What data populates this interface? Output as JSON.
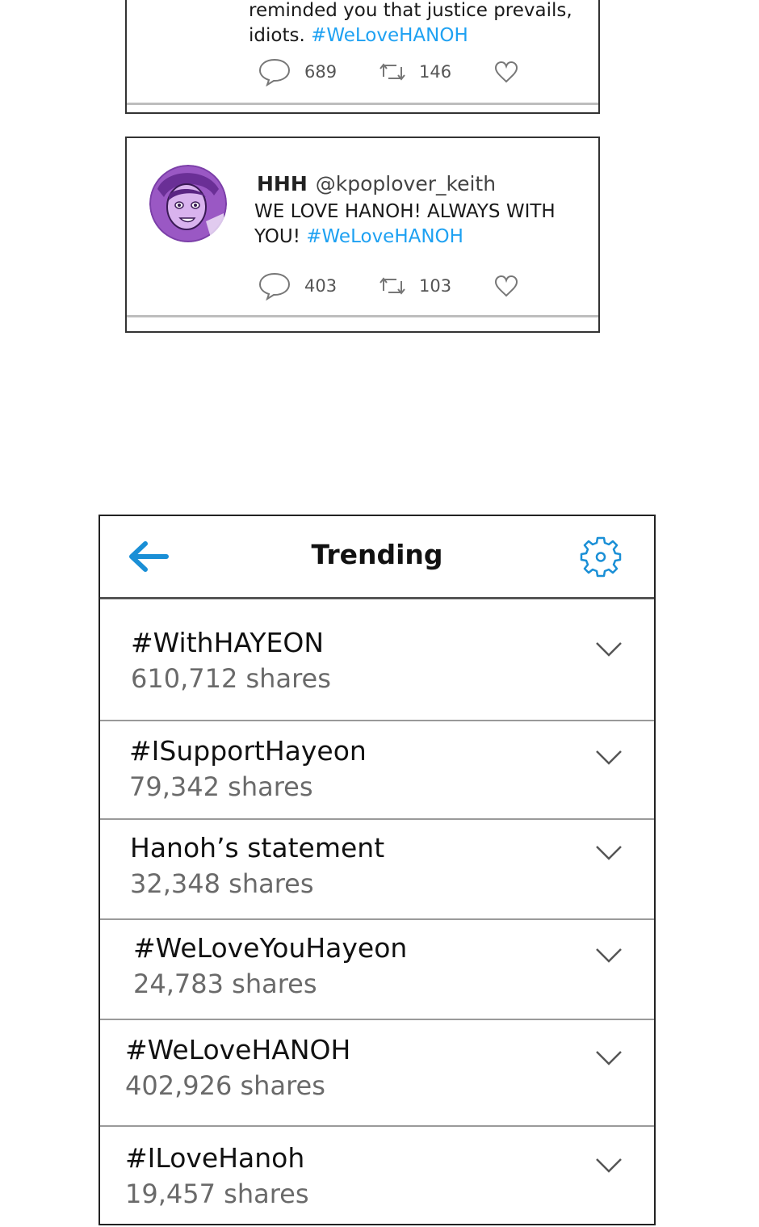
{
  "tweets": [
    {
      "text_line1": "reminded you that justice prevails,",
      "text_line2_prefix": "idiots. ",
      "hashtag": "#WeLoveHANOH",
      "replies": "689",
      "retweets": "146"
    },
    {
      "name": "HHH",
      "handle": "@kpoplover_keith",
      "text_line1": "WE LOVE HANOH! ALWAYS WITH",
      "text_line2_prefix": "YOU! ",
      "hashtag": "#WeLoveHANOH",
      "replies": "403",
      "retweets": "103"
    }
  ],
  "trending": {
    "title": "Trending",
    "items": [
      {
        "name": "#WithHAYEON",
        "shares": "610,712 shares"
      },
      {
        "name": "#ISupportHayeon",
        "shares": "79,342 shares"
      },
      {
        "name": "Hanoh’s statement",
        "shares": "32,348 shares"
      },
      {
        "name": "#WeLoveYouHayeon",
        "shares": "24,783 shares"
      },
      {
        "name": "#WeLoveHANOH",
        "shares": "402,926 shares"
      },
      {
        "name": "#ILoveHanoh",
        "shares": "19,457 shares"
      }
    ]
  },
  "colors": {
    "hashtag": "#1ea1f2",
    "accent_icon": "#1a8fd6",
    "border": "#222222"
  },
  "icons": {
    "reply": "speech-bubble-icon",
    "retweet": "retweet-icon",
    "like": "heart-icon",
    "back": "arrow-left-icon",
    "settings": "gear-icon",
    "expand": "chevron-down-icon"
  }
}
